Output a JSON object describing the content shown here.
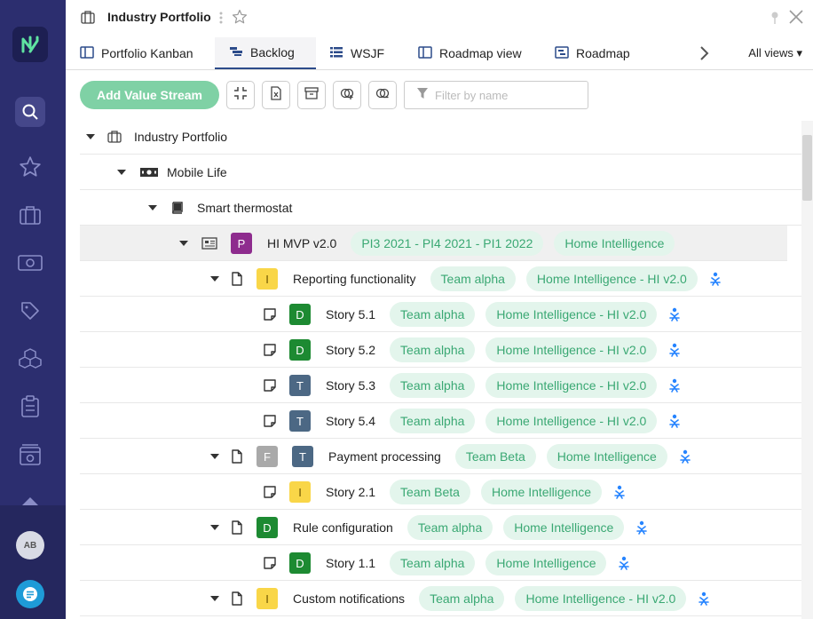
{
  "window": {
    "title": "Industry Portfolio"
  },
  "tabs": [
    {
      "label": "Portfolio Kanban",
      "icon": "board-icon"
    },
    {
      "label": "Backlog",
      "icon": "backlog-icon",
      "active": true
    },
    {
      "label": "WSJF",
      "icon": "list-icon"
    },
    {
      "label": "Roadmap view",
      "icon": "board-icon"
    },
    {
      "label": "Roadmap",
      "icon": "roadmap-icon"
    }
  ],
  "all_views_label": "All views ▾",
  "toolbar": {
    "add_label": "Add Value Stream",
    "filter_placeholder": "Filter by name"
  },
  "user": {
    "initials": "AB"
  },
  "colors": {
    "rail": "#2c2e6f",
    "add_button": "#7fd1a5",
    "tag_bg": "#e3f5ec",
    "tag_text": "#3aa873",
    "badge_P": "#8e2c8e",
    "badge_I": "#f9d648",
    "badge_D": "#1d8a32",
    "badge_T": "#4c6884",
    "badge_F": "#a9a9a9",
    "jira": "#2684ff"
  },
  "tree": [
    {
      "level": 0,
      "icon": "portfolio-icon",
      "name": "Industry Portfolio",
      "tags": []
    },
    {
      "level": 1,
      "icon": "money-icon",
      "name": "Mobile Life",
      "tags": []
    },
    {
      "level": 2,
      "icon": "book-icon",
      "name": "Smart thermostat",
      "tags": []
    },
    {
      "level": 3,
      "icon": "newspaper-icon",
      "badges": [
        "P"
      ],
      "name": "HI MVP v2.0",
      "tags": [
        "PI3 2021 - PI4 2021 - PI1 2022",
        "Home Intelligence"
      ],
      "highlight": true
    },
    {
      "level": 4,
      "icon": "file-icon",
      "badges": [
        "I"
      ],
      "name": "Reporting functionality",
      "tags": [
        "Team alpha",
        "Home Intelligence - HI v2.0"
      ],
      "jira": true,
      "caret": true
    },
    {
      "level": 5,
      "icon": "note-icon",
      "badges": [
        "D"
      ],
      "name": "Story 5.1",
      "tags": [
        "Team alpha",
        "Home Intelligence - HI v2.0"
      ],
      "jira": true
    },
    {
      "level": 5,
      "icon": "note-icon",
      "badges": [
        "D"
      ],
      "name": "Story 5.2",
      "tags": [
        "Team alpha",
        "Home Intelligence - HI v2.0"
      ],
      "jira": true
    },
    {
      "level": 5,
      "icon": "note-icon",
      "badges": [
        "T"
      ],
      "name": "Story 5.3",
      "tags": [
        "Team alpha",
        "Home Intelligence - HI v2.0"
      ],
      "jira": true
    },
    {
      "level": 5,
      "icon": "note-icon",
      "badges": [
        "T"
      ],
      "name": "Story 5.4",
      "tags": [
        "Team alpha",
        "Home Intelligence - HI v2.0"
      ],
      "jira": true
    },
    {
      "level": 4,
      "icon": "file-icon",
      "badges": [
        "F",
        "T"
      ],
      "name": "Payment processing",
      "tags": [
        "Team Beta",
        "Home Intelligence"
      ],
      "jira": true,
      "caret": true
    },
    {
      "level": 5,
      "icon": "note-icon",
      "badges": [
        "I"
      ],
      "name": "Story 2.1",
      "tags": [
        "Team Beta",
        "Home Intelligence"
      ],
      "jira": true
    },
    {
      "level": 4,
      "icon": "file-icon",
      "badges": [
        "D"
      ],
      "name": "Rule configuration",
      "tags": [
        "Team alpha",
        "Home Intelligence"
      ],
      "jira": true,
      "caret": true
    },
    {
      "level": 5,
      "icon": "note-icon",
      "badges": [
        "D"
      ],
      "name": "Story 1.1",
      "tags": [
        "Team alpha",
        "Home Intelligence"
      ],
      "jira": true
    },
    {
      "level": 4,
      "icon": "file-icon",
      "badges": [
        "I"
      ],
      "name": "Custom notifications",
      "tags": [
        "Team alpha",
        "Home Intelligence - HI v2.0"
      ],
      "jira": true,
      "caret": true
    }
  ]
}
